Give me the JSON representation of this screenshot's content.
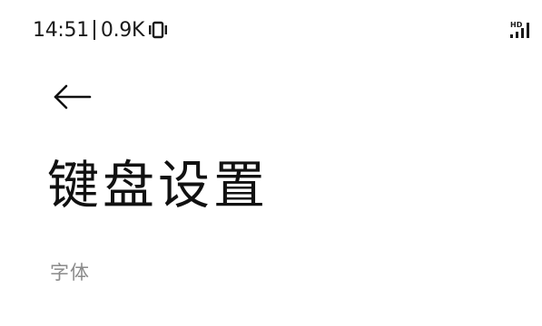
{
  "status_bar": {
    "time": "14:51",
    "network_speed": "0.9K",
    "icons": [
      "vibrate-icon",
      "hd-signal-icon"
    ],
    "hd_label": "HD"
  },
  "header": {
    "back_icon": "arrow-left-icon",
    "title": "键盘设置"
  },
  "sections": [
    {
      "label": "字体"
    }
  ],
  "colors": {
    "background": "#ffffff",
    "text": "#111111",
    "section_label": "#8a8a8a"
  }
}
